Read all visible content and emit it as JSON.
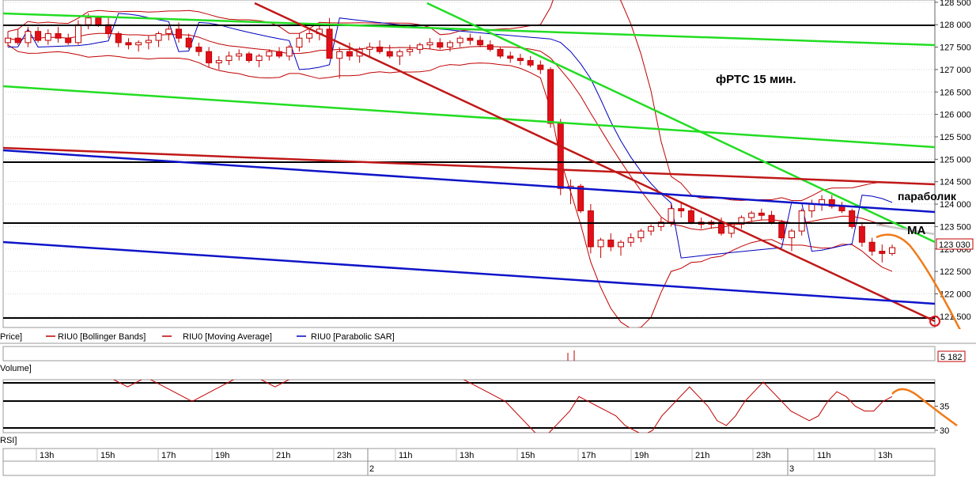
{
  "chart_data": {
    "type": "candlestick",
    "title": "фРТС   15 мин.",
    "main_panel": {
      "ylim": [
        121250,
        128550
      ],
      "yticks": [
        121500,
        122000,
        122500,
        123000,
        123500,
        124000,
        124500,
        125000,
        125500,
        126000,
        126500,
        127000,
        127500,
        128000,
        128500
      ],
      "ytick_labels": [
        "121 500",
        "122 000",
        "122 500",
        "123 000",
        "123 500",
        "124 000",
        "124 500",
        "125 000",
        "125 500",
        "126 000",
        "126 500",
        "127 000",
        "127 500",
        "128 000",
        "128 500"
      ],
      "last_price_label": "123 030",
      "last_price": 123030,
      "candles": [
        [
          127600,
          127850,
          127500,
          127700
        ],
        [
          127700,
          127900,
          127550,
          127600
        ],
        [
          127600,
          127950,
          127500,
          127850
        ],
        [
          127850,
          127950,
          127600,
          127650
        ],
        [
          127650,
          127900,
          127550,
          127800
        ],
        [
          127800,
          127950,
          127600,
          127700
        ],
        [
          127700,
          127800,
          127550,
          127600
        ],
        [
          127600,
          128100,
          127550,
          128000
        ],
        [
          128000,
          128250,
          127900,
          128150
        ],
        [
          128150,
          128200,
          127950,
          128000
        ],
        [
          128000,
          128150,
          127700,
          127800
        ],
        [
          127800,
          127850,
          127500,
          127600
        ],
        [
          127600,
          127700,
          127450,
          127550
        ],
        [
          127550,
          127650,
          127400,
          127600
        ],
        [
          127600,
          127750,
          127450,
          127650
        ],
        [
          127650,
          127850,
          127500,
          127800
        ],
        [
          127800,
          128000,
          127650,
          127900
        ],
        [
          127900,
          128050,
          127600,
          127700
        ],
        [
          127700,
          127800,
          127450,
          127500
        ],
        [
          127500,
          127600,
          127300,
          127400
        ],
        [
          127400,
          127500,
          127050,
          127150
        ],
        [
          127150,
          127300,
          127000,
          127200
        ],
        [
          127200,
          127400,
          127100,
          127300
        ],
        [
          127300,
          127450,
          127200,
          127350
        ],
        [
          127350,
          127400,
          127150,
          127200
        ],
        [
          127200,
          127350,
          127050,
          127300
        ],
        [
          127300,
          127450,
          127200,
          127400
        ],
        [
          127400,
          127500,
          127250,
          127300
        ],
        [
          127300,
          127550,
          127200,
          127500
        ],
        [
          127500,
          127800,
          127400,
          127700
        ],
        [
          127700,
          127900,
          127600,
          127800
        ],
        [
          127800,
          128000,
          127650,
          127900
        ],
        [
          127900,
          128150,
          127700,
          127250
        ],
        [
          127250,
          127500,
          126800,
          127400
        ],
        [
          127400,
          127600,
          127200,
          127300
        ],
        [
          127300,
          127500,
          127150,
          127450
        ],
        [
          127450,
          127600,
          127300,
          127500
        ],
        [
          127500,
          127650,
          127350,
          127400
        ],
        [
          127400,
          127550,
          127250,
          127300
        ],
        [
          127300,
          127450,
          127100,
          127400
        ],
        [
          127400,
          127550,
          127300,
          127450
        ],
        [
          127450,
          127600,
          127350,
          127550
        ],
        [
          127550,
          127700,
          127450,
          127600
        ],
        [
          127600,
          127700,
          127450,
          127500
        ],
        [
          127500,
          127650,
          127400,
          127600
        ],
        [
          127600,
          127750,
          127500,
          127700
        ],
        [
          127700,
          127800,
          127550,
          127650
        ],
        [
          127650,
          127750,
          127500,
          127550
        ],
        [
          127550,
          127650,
          127400,
          127450
        ],
        [
          127450,
          127500,
          127250,
          127300
        ],
        [
          127300,
          127400,
          127150,
          127250
        ],
        [
          127250,
          127350,
          127100,
          127200
        ],
        [
          127200,
          127300,
          127050,
          127100
        ],
        [
          127100,
          127200,
          126900,
          127000
        ],
        [
          127000,
          127050,
          125700,
          125800
        ],
        [
          125800,
          125900,
          124200,
          124350
        ],
        [
          124350,
          124550,
          124000,
          124400
        ],
        [
          124400,
          124450,
          123800,
          123850
        ],
        [
          123850,
          124000,
          122900,
          123050
        ],
        [
          123050,
          123250,
          122800,
          123200
        ],
        [
          123200,
          123350,
          122950,
          123050
        ],
        [
          123050,
          123200,
          122850,
          123150
        ],
        [
          123150,
          123350,
          123050,
          123250
        ],
        [
          123250,
          123450,
          123150,
          123400
        ],
        [
          123400,
          123550,
          123300,
          123500
        ],
        [
          123500,
          123700,
          123400,
          123600
        ],
        [
          123600,
          124000,
          123500,
          123900
        ],
        [
          123900,
          124050,
          123700,
          123850
        ],
        [
          123850,
          123950,
          123550,
          123600
        ],
        [
          123600,
          123700,
          123450,
          123550
        ],
        [
          123550,
          123650,
          123450,
          123600
        ],
        [
          123600,
          123700,
          123300,
          123350
        ],
        [
          123350,
          123600,
          123250,
          123550
        ],
        [
          123550,
          123750,
          123450,
          123700
        ],
        [
          123700,
          123850,
          123600,
          123800
        ],
        [
          123800,
          123900,
          123650,
          123750
        ],
        [
          123750,
          123850,
          123550,
          123600
        ],
        [
          123600,
          123650,
          123200,
          123250
        ],
        [
          123250,
          123450,
          122950,
          123400
        ],
        [
          123400,
          123900,
          123300,
          123850
        ],
        [
          123850,
          124100,
          123700,
          124000
        ],
        [
          124000,
          124200,
          123850,
          124100
        ],
        [
          124100,
          124200,
          123900,
          123950
        ],
        [
          123950,
          124050,
          123800,
          123850
        ],
        [
          123850,
          123900,
          123450,
          123500
        ],
        [
          123500,
          123600,
          123050,
          123150
        ],
        [
          123150,
          123250,
          122850,
          122950
        ],
        [
          122950,
          123100,
          122700,
          122900
        ],
        [
          122900,
          123100,
          122850,
          123030
        ]
      ],
      "moving_average_label": "RIU0 [Moving Average]",
      "bollinger_label": "RIU0 [Bollinger Bands]",
      "parabolic_label": "RIU0 [Parabolic SAR]",
      "price_label": "Price]"
    },
    "annotations": [
      {
        "text": "параболик"
      },
      {
        "text": "MA"
      }
    ],
    "volume_panel": {
      "label": "Volume]",
      "last_value_label": "5 182"
    },
    "rsi_panel": {
      "label": "RSI]",
      "yticks": [
        30,
        35
      ],
      "ytick_labels": [
        "30",
        "35"
      ],
      "ylim": [
        29.5,
        40.5
      ],
      "values": [
        47,
        46,
        45,
        44,
        43,
        44,
        45,
        44,
        43,
        44,
        42,
        41,
        40,
        39,
        40,
        41,
        40,
        39,
        38,
        37,
        36,
        37,
        38,
        39,
        40,
        41,
        42,
        41,
        40,
        39,
        40,
        41,
        42,
        43,
        42,
        41,
        42,
        43,
        42,
        41,
        42,
        43,
        44,
        43,
        42,
        43,
        44,
        43,
        42,
        41,
        40,
        39,
        38,
        37,
        36,
        34,
        32,
        30,
        28,
        30,
        32,
        34,
        37,
        36,
        35,
        34,
        33,
        31,
        30,
        29,
        30,
        33,
        35,
        37,
        39,
        37,
        35,
        32,
        31,
        33,
        36,
        38,
        40,
        38,
        36,
        34,
        33,
        32,
        33,
        36,
        38,
        37,
        35,
        34,
        34,
        36,
        37
      ]
    },
    "x_axis": {
      "labels": [
        "13h",
        "15h",
        "17h",
        "19h",
        "21h",
        "23h",
        "2",
        "11h",
        "13h",
        "15h",
        "17h",
        "19h",
        "21h",
        "23h",
        "3",
        "11h",
        "13h"
      ]
    },
    "colors": {
      "up_candle": "#ffffff",
      "down_candle": "#e0101a",
      "candle_outline": "#c00000",
      "bollinger": "#c00000",
      "moving_average": "#c00000",
      "parabolic_sar": "#0000c0",
      "trend_green": "#22dd22",
      "trend_red": "#c01818",
      "trend_blue": "#0e14c8",
      "horizontal_black": "#000000",
      "forecast_orange": "#f07a18"
    }
  }
}
